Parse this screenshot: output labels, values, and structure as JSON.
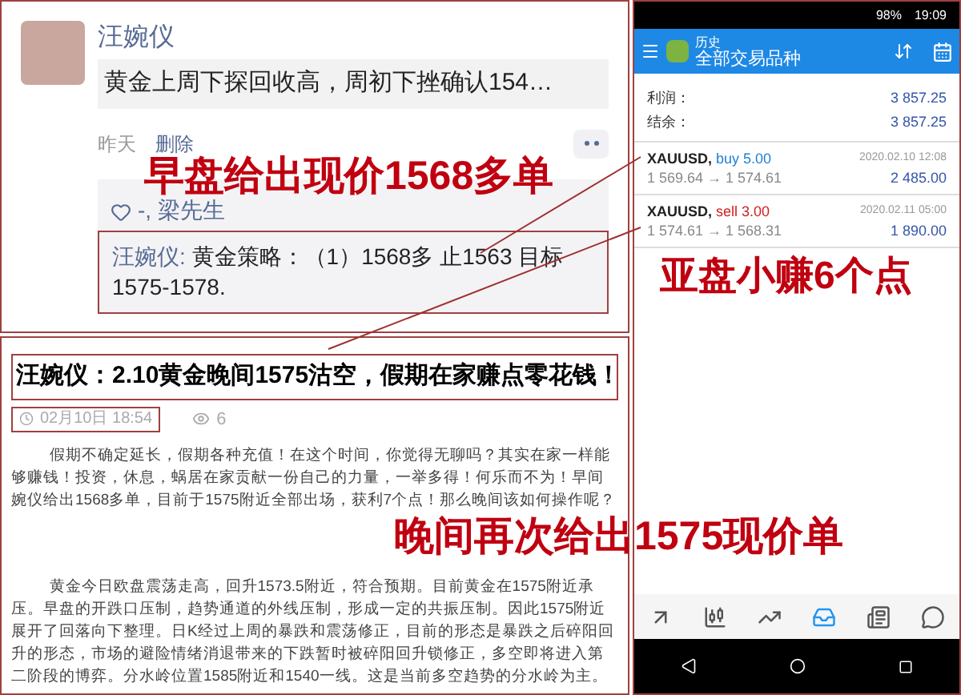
{
  "post": {
    "author": "汪婉仪",
    "text": "黄金上周下探回收高，周初下挫确认154…",
    "time": "昨天",
    "delete": "删除",
    "likes": "-, 梁先生",
    "comment_author": "汪婉仪:",
    "comment_text": "黄金策略：（1）1568多  止1563  目标1575-1578."
  },
  "article": {
    "title": "汪婉仪：2.10黄金晚间1575沽空，假期在家赚点零花钱！",
    "date": "02月10日 18:54",
    "views": "6",
    "paragraphs": [
      "假期不确定延长，假期各种充值！在这个时间，你觉得无聊吗？其实在家一样能够赚钱！投资，休息，蜗居在家贡献一份自己的力量，一举多得！何乐而不为！早间婉仪给出1568多单，目前于1575附近全部出场，获利7个点！那么晚间该如何操作呢？",
      "黄金今日欧盘震荡走高，回升1573.5附近，符合预期。目前黄金在1575附近承压。早盘的开跌口压制，趋势通道的外线压制，形成一定的共振压制。因此1575附近展开了回落向下整理。日K经过上周的暴跌和震荡修正，目前的形态是暴跌之后碎阳回升的形态，市场的避险情绪消退带来的下跌暂时被碎阳回升锁修正，多空即将进入第二阶段的博弈。分水岭位置1585附近和1540一线。这是当前多空趋势的分水岭为主。"
    ]
  },
  "phone": {
    "status_bar": {
      "battery": "98%",
      "time": "19:09"
    },
    "header": {
      "subtitle": "历史",
      "title": "全部交易品种"
    },
    "summary": [
      {
        "label": "利润：",
        "value": "3 857.25"
      },
      {
        "label": "结余：",
        "value": "3 857.25"
      }
    ],
    "trades": [
      {
        "symbol": "XAUUSD,",
        "side": "buy 5.00",
        "kind": "buy",
        "prices": "1 569.64 → 1 574.61",
        "time": "2020.02.10 12:08",
        "profit": "2 485.00"
      },
      {
        "symbol": "XAUUSD,",
        "side": "sell 3.00",
        "kind": "sell",
        "prices": "1 574.61 → 1 568.31",
        "time": "2020.02.11 05:00",
        "profit": "1 890.00"
      }
    ],
    "nav": [
      {
        "kind": "quotes",
        "selected": false
      },
      {
        "kind": "chart",
        "selected": false
      },
      {
        "kind": "trade",
        "selected": false
      },
      {
        "kind": "history",
        "selected": true
      },
      {
        "kind": "news",
        "selected": false
      },
      {
        "kind": "chat",
        "selected": false
      }
    ]
  },
  "annotations": [
    {
      "text": "早盘给出现价1568多单"
    },
    {
      "text": "亚盘小赚6个点"
    },
    {
      "text": "晚间再次给出1575现价单"
    }
  ]
}
